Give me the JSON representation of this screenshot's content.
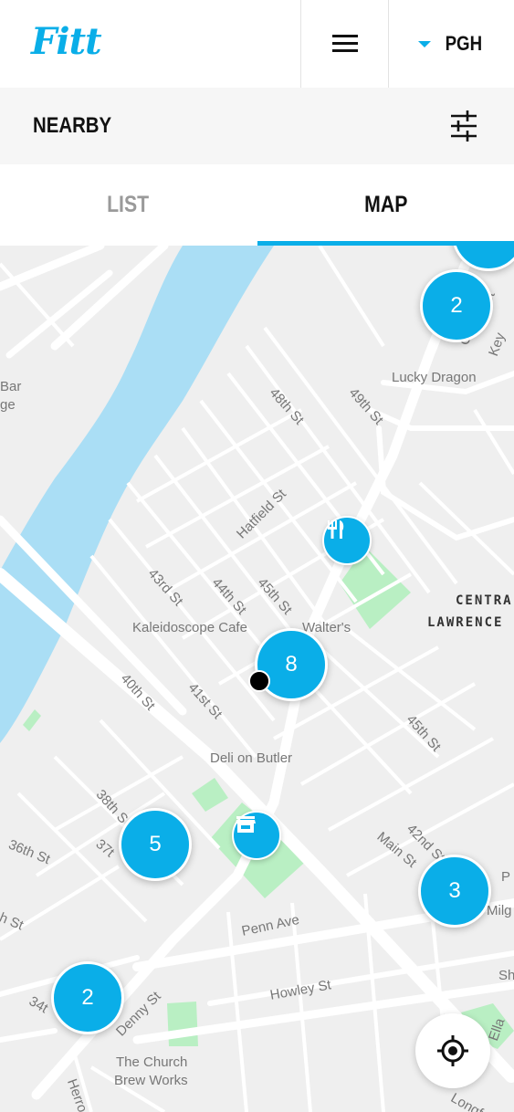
{
  "header": {
    "logo_text": "Fitt",
    "menu_icon": "hamburger-menu-icon",
    "city_dropdown": {
      "caret_icon": "caret-down-icon",
      "selected_value": "PGH"
    }
  },
  "subheader": {
    "title": "NEARBY",
    "filter_icon": "filter-sliders-icon"
  },
  "tabs": [
    {
      "label": "LIST",
      "active": false
    },
    {
      "label": "MAP",
      "active": true
    }
  ],
  "colors": {
    "accent": "#0aaee8",
    "river": "#aadef5",
    "park": "#b9efc3",
    "map_bg": "#efefef",
    "road": "#ffffff"
  },
  "map": {
    "places": {
      "lucky_dragon": "Lucky Dragon",
      "kaleidoscope": "Kaleidoscope Cafe",
      "walters": "Walter's",
      "deli": "Deli on Butler",
      "church": "The Church",
      "church2": "Brew Works",
      "bar_partial": "Bar",
      "ge_partial": "ge"
    },
    "streets": {
      "s48": "48th St",
      "s49": "49th St",
      "hatfield": "Hatfield St",
      "s43": "43rd St",
      "s44": "44th St",
      "s45a": "45th St",
      "s40": "40th St",
      "s41": "41st St",
      "s45b": "45th St",
      "s38": "38th S",
      "s37": "37t",
      "s36": "36th St",
      "h_st": "h St",
      "s34": "34t",
      "penn": "Penn Ave",
      "howley": "Howley St",
      "denny": "Denny St",
      "main": "Main St",
      "s42": "42nd St",
      "herron": "Herro",
      "carr": "Carr",
      "keyw": "Key",
      "milg": "Milg",
      "p_partial": "P",
      "sh_partial": "Sh",
      "ella": "Ella",
      "longf": "Longfe",
      "st_partial": "St"
    },
    "district": {
      "line1": "CENTRA",
      "line2": "LAWRENCE"
    },
    "clusters": [
      {
        "count": "2",
        "name": "cluster-top-right"
      },
      {
        "count": "8",
        "name": "cluster-center"
      },
      {
        "count": "5",
        "name": "cluster-left"
      },
      {
        "count": "3",
        "name": "cluster-right"
      },
      {
        "count": "2",
        "name": "cluster-bottom-left"
      }
    ],
    "pins": [
      {
        "type": "restaurant",
        "icon": "fork-knife-icon"
      },
      {
        "type": "store",
        "icon": "storefront-icon"
      }
    ],
    "user_location_icon": "user-location-dot",
    "locate_button_icon": "crosshair-locate-icon"
  }
}
